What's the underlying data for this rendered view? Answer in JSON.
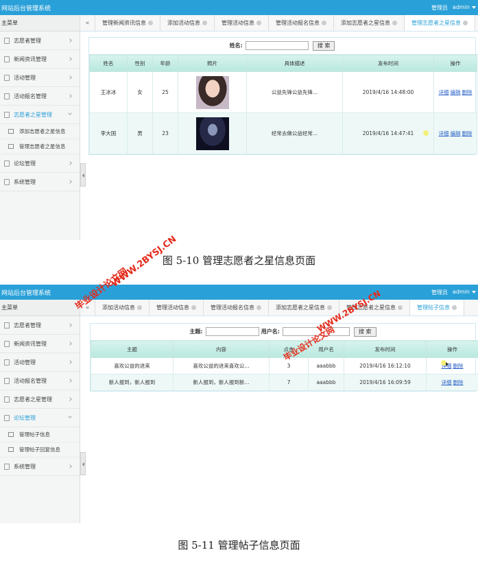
{
  "screen1": {
    "app_title": "网站后台管理系统",
    "role": "管理员",
    "user": "admin",
    "sidebar_header": "主菜单",
    "menu": [
      {
        "label": "志愿者管理"
      },
      {
        "label": "新闻资讯管理"
      },
      {
        "label": "活动管理"
      },
      {
        "label": "活动报名管理"
      },
      {
        "label": "志愿者之星管理",
        "open": true
      },
      {
        "label": "添加志愿者之星信息",
        "sub": true
      },
      {
        "label": "管理志愿者之星信息",
        "sub": true
      },
      {
        "label": "论坛管理"
      },
      {
        "label": "系统管理"
      }
    ],
    "tabs": [
      "管理新闻资讯信息",
      "添加活动信息",
      "管理活动信息",
      "管理活动报名信息",
      "添加志愿者之星信息",
      "管理志愿者之星信息"
    ],
    "active_tab": 5,
    "search": {
      "label": "姓名:",
      "button": "搜 索"
    },
    "columns": [
      "姓名",
      "性别",
      "年龄",
      "照片",
      "具体描述",
      "发布时间",
      "操作"
    ],
    "rows": [
      {
        "name": "王冰冰",
        "gender": "女",
        "age": "25",
        "desc": "公益先锋公益先锋...",
        "time": "2019/4/16 14:48:00"
      },
      {
        "name": "李大国",
        "gender": "男",
        "age": "23",
        "desc": "经常去做公益经常...",
        "time": "2019/4/16 14:47:41"
      }
    ],
    "ops": [
      "详细",
      "编辑",
      "删除"
    ]
  },
  "caption1": "图 5-10 管理志愿者之星信息页面",
  "screen2": {
    "app_title": "网站后台管理系统",
    "role": "管理员",
    "user": "admin",
    "sidebar_header": "主菜单",
    "menu": [
      {
        "label": "志愿者管理"
      },
      {
        "label": "新闻资讯管理"
      },
      {
        "label": "活动管理"
      },
      {
        "label": "活动报名管理"
      },
      {
        "label": "志愿者之星管理"
      },
      {
        "label": "论坛管理",
        "open": true
      },
      {
        "label": "管理帖子信息",
        "sub": true
      },
      {
        "label": "管理帖子回复信息",
        "sub": true
      },
      {
        "label": "系统管理"
      }
    ],
    "tabs": [
      "添加活动信息",
      "管理活动信息",
      "管理活动报名信息",
      "添加志愿者之星信息",
      "管理志愿者之星信息",
      "管理帖子信息"
    ],
    "active_tab": 5,
    "search": {
      "label1": "主题:",
      "label2": "用户名:",
      "button": "搜 索"
    },
    "columns": [
      "主题",
      "内容",
      "点击",
      "用户名",
      "发布时间",
      "操作"
    ],
    "rows": [
      {
        "topic": "喜欢公益的进来",
        "content": "喜欢公益的进来喜欢公...",
        "clicks": "3",
        "user": "aaabbb",
        "time": "2019/4/16 16:12:10"
      },
      {
        "topic": "新人报到，新人报到",
        "content": "新人报到，新人报到新...",
        "clicks": "7",
        "user": "aaabbb",
        "time": "2019/4/16 16:09:59"
      }
    ],
    "ops": [
      "详细",
      "删除"
    ]
  },
  "caption2": "图 5-11 管理帖子信息页面",
  "watermarks": [
    "毕业设计论文网",
    "WWW.2BYSJ.CN"
  ],
  "colors": {
    "topbar": "#2aa0d8",
    "header_grad": "#b8e8de",
    "watermark": "#e42a1a",
    "link": "#2a62c9"
  }
}
